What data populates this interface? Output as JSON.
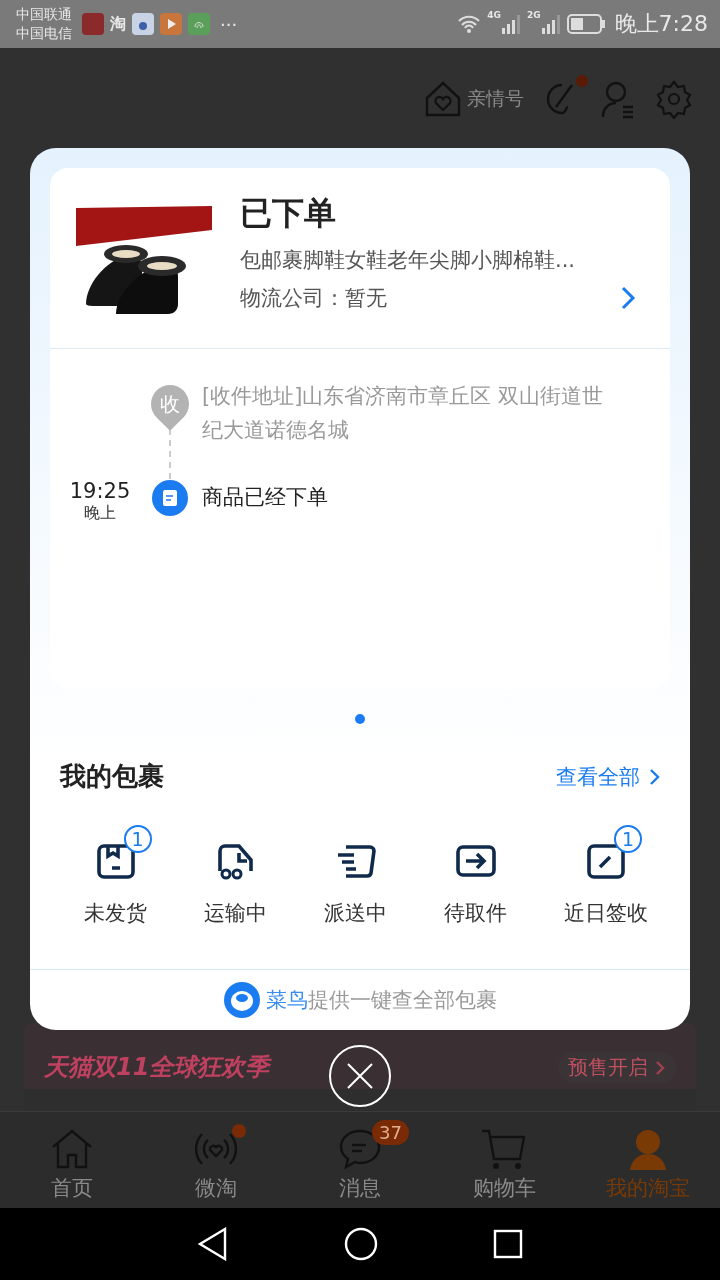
{
  "status_bar": {
    "carriers": [
      "中国联通",
      "中国电信"
    ],
    "app_glyph": "淘",
    "more": "···",
    "networks": [
      "4G",
      "2G"
    ],
    "time": "晚上7:28"
  },
  "header": {
    "family_label": "亲情号",
    "palette_dot": true
  },
  "banner": {
    "title": "天猫双11全球狂欢季",
    "action": "预售开启"
  },
  "order_card": {
    "status": "已下单",
    "product": "包邮裹脚鞋女鞋老年尖脚小脚棉鞋...",
    "logistics": "物流公司：暂无",
    "address_marker": "收",
    "address": "[收件地址]山东省济南市章丘区 双山街道世纪大道诺德名城",
    "events": [
      {
        "time": "19:25",
        "period": "晚上",
        "text": "商品已经下单"
      }
    ]
  },
  "pager": [
    {
      "selected": true
    }
  ],
  "packages": {
    "title": "我的包裹",
    "view_all": "查看全部",
    "items": [
      {
        "kind": "box",
        "label": "未发货",
        "badge": "1"
      },
      {
        "kind": "truck",
        "label": "运输中"
      },
      {
        "kind": "delivery",
        "label": "派送中"
      },
      {
        "kind": "pickup",
        "label": "待取件"
      },
      {
        "kind": "signed",
        "label": "近日签收",
        "badge": "1"
      }
    ]
  },
  "footer": {
    "brand": "菜鸟",
    "text": "提供一键查全部包裹"
  },
  "tabs": [
    {
      "kind": "home",
      "label": "首页",
      "selected": false,
      "dot": false
    },
    {
      "kind": "feed",
      "label": "微淘",
      "selected": false,
      "dot": true
    },
    {
      "kind": "message",
      "label": "消息",
      "selected": false,
      "dot": false,
      "badge": "37"
    },
    {
      "kind": "cart",
      "label": "购物车",
      "selected": false,
      "dot": false
    },
    {
      "kind": "me",
      "label": "我的淘宝",
      "selected": true,
      "dot": false
    }
  ]
}
